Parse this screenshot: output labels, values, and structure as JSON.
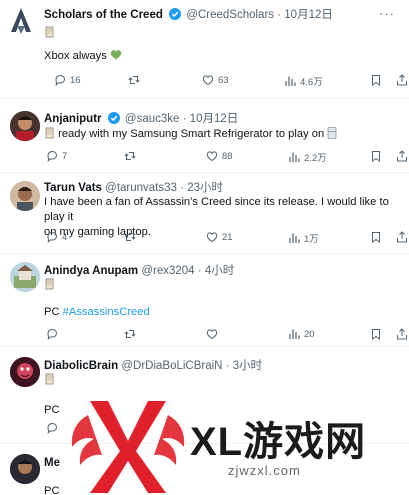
{
  "tweets": [
    {
      "name": "Scholars of the Creed",
      "handle": "@CreedScholars",
      "time": "10月12日",
      "line1_pre": "",
      "line1": "",
      "line2": "Xbox always",
      "reply_count": "16",
      "like_count": "63",
      "view_count": "4.6万"
    },
    {
      "name": "Anjaniputr",
      "handle": "@sauc3ke",
      "time": "10月12日",
      "line1": "ready with my Samsung Smart Refrigerator to play on",
      "reply_count": "7",
      "like_count": "88",
      "view_count": "2.2万"
    },
    {
      "name": "Tarun Vats",
      "handle": "@tarunvats33",
      "time": "23小时",
      "line1": "I have been a fan of Assassin's Creed since its release. I would like to play it",
      "line2": "on my gaming laptop.",
      "reply_count": "4",
      "like_count": "21",
      "view_count": "1万"
    },
    {
      "name": "Anindya Anupam",
      "handle": "@rex3204",
      "time": "4小时",
      "text": "PC",
      "hashtag": "#AssassinsCreed",
      "like_count": "20"
    },
    {
      "name": "DiabolicBrain",
      "handle": "@DrDiaBoLiCBraiN",
      "time": "3小时",
      "text": "PC"
    },
    {
      "name": "Me",
      "text": "PC"
    }
  ],
  "separator": "·",
  "more_label": "···",
  "watermark": {
    "title": "XL游戏网",
    "url": "zjwzxl.com"
  },
  "colors": {
    "accent": "#1d9bf0",
    "muted": "#536471",
    "divider": "#eff3f4",
    "watermark_red": "#e0202a"
  }
}
